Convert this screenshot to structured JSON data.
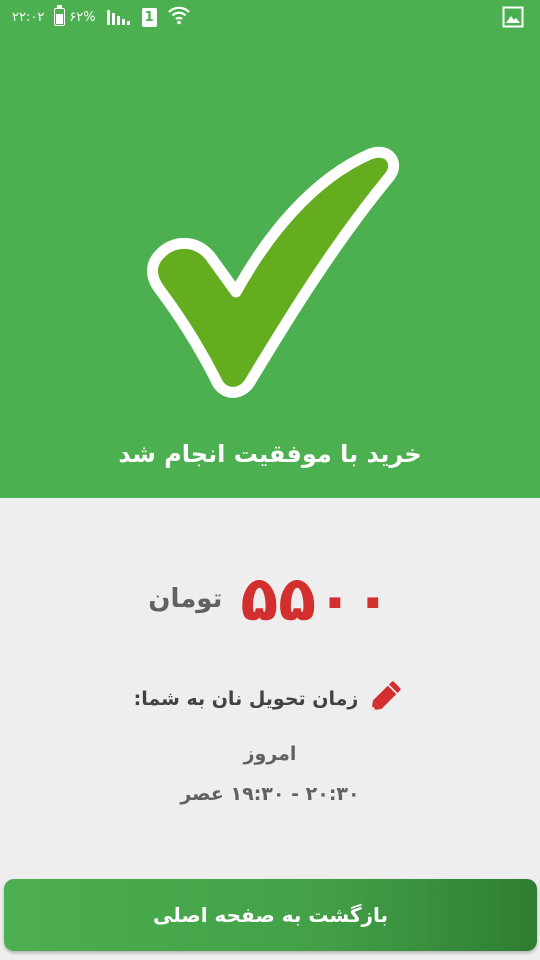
{
  "status_bar": {
    "time": "۲۲:۰۲",
    "battery": "۶۲%",
    "sim_slot": "1",
    "icons": [
      "battery-icon",
      "signal-icon",
      "sim-icon",
      "wifi-icon",
      "gallery-notification-icon"
    ]
  },
  "hero": {
    "icon": "checkmark-icon",
    "title": "خرید با موفقیت انجام شد",
    "background_color": "#4caf50",
    "check_color": "#63ad1f"
  },
  "amount": {
    "value": "۵۵۰۰",
    "unit": "تومان",
    "value_color": "#d32f2f"
  },
  "delivery": {
    "icon": "pencil-icon",
    "heading": "زمان تحویل نان به شما:",
    "day": "امروز",
    "time_range": "۲۰:۳۰ - ۱۹:۳۰ عصر"
  },
  "footer": {
    "back_button_label": "بازگشت به صفحه اصلی"
  }
}
